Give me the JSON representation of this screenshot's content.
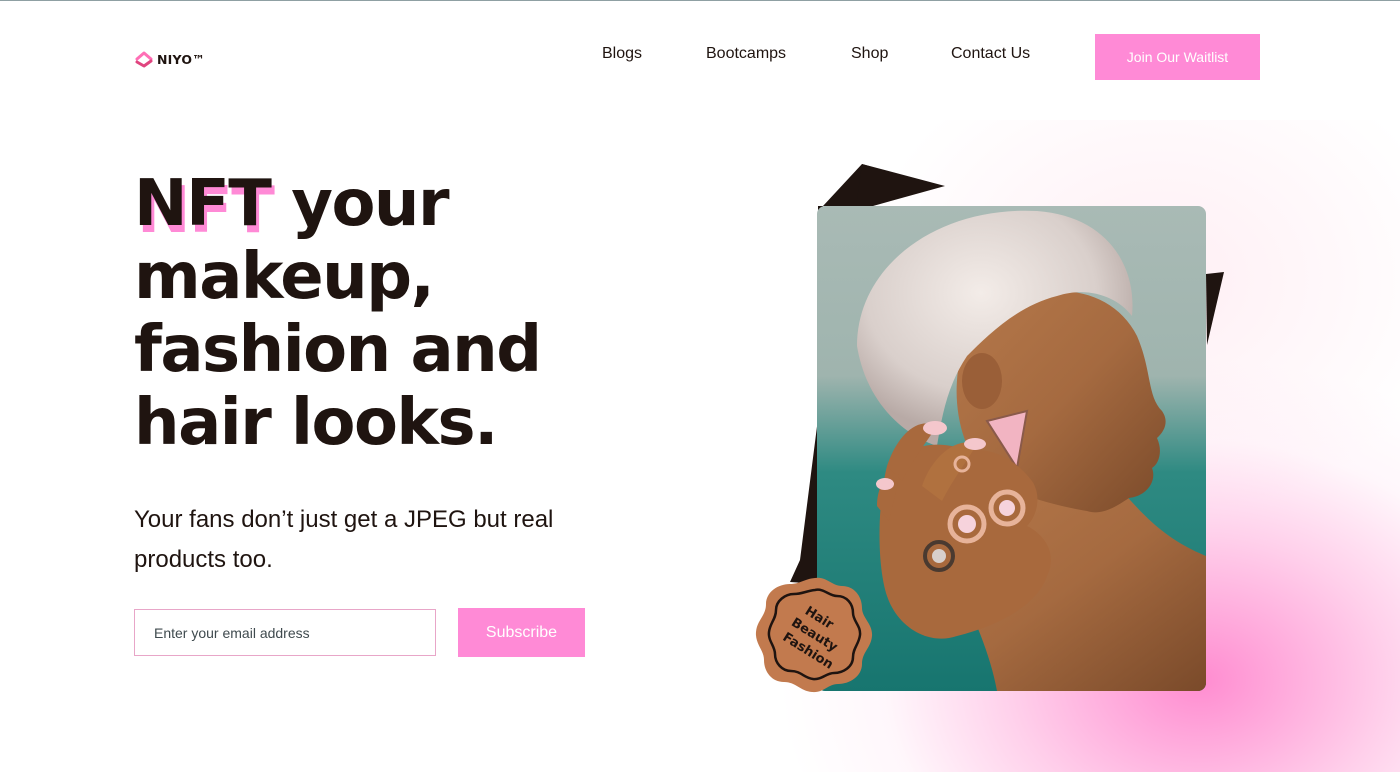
{
  "header": {
    "logo_text": "NIYO™",
    "nav": [
      {
        "label": "Blogs"
      },
      {
        "label": "Bootcamps"
      },
      {
        "label": "Shop"
      },
      {
        "label": "Contact Us"
      }
    ],
    "cta_label": "Join Our Waitlist"
  },
  "hero": {
    "title_highlight": "NFT",
    "title_line1_rest": " your",
    "title_line2": "makeup,",
    "title_line3": "fashion and",
    "title_line4": "hair looks.",
    "subtitle_line1": "Your fans don’t just get a JPEG but real",
    "subtitle_line2": "products too.",
    "email_placeholder": "Enter your email address",
    "subscribe_label": "Subscribe"
  },
  "badge": {
    "line1": "Hair",
    "line2": "Beauty",
    "line3": "Fashion"
  },
  "colors": {
    "accent_pink": "#ff8ad6",
    "text_dark": "#1f1410",
    "badge_brown": "#c27a4e"
  },
  "icons": {
    "logo": "niyo-logo-icon"
  }
}
